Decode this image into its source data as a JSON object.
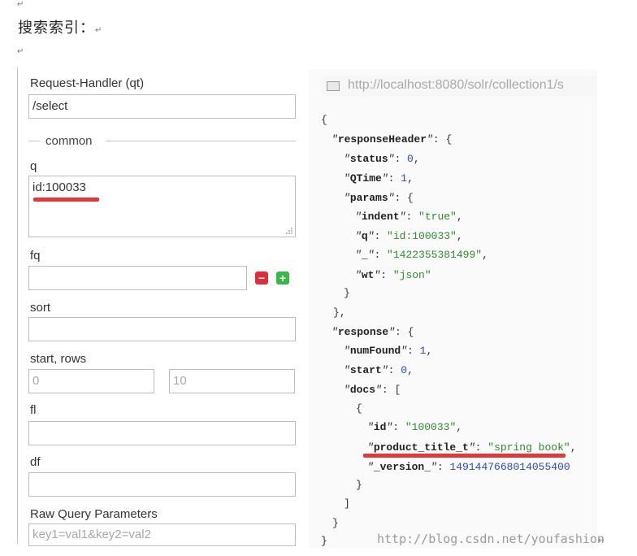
{
  "doc": {
    "heading": "搜索索引：",
    "para_mark": "↵"
  },
  "form": {
    "handler_label": "Request-Handler (qt)",
    "handler_value": "/select",
    "common_label": "common",
    "q_label": "q",
    "q_value": "id:100033",
    "fq_label": "fq",
    "fq_value": "",
    "remove_btn": "−",
    "add_btn": "+",
    "sort_label": "sort",
    "sort_value": "",
    "start_rows_label": "start, rows",
    "start_placeholder": "0",
    "rows_placeholder": "10",
    "fl_label": "fl",
    "fl_value": "",
    "df_label": "df",
    "df_value": "",
    "raw_label": "Raw Query Parameters",
    "raw_placeholder": "key1=val1&key2=val2"
  },
  "response": {
    "url": "http://localhost:8080/solr/collection1/s",
    "open_brace": "{",
    "close_brace": "}",
    "responseHeader_key": "responseHeader",
    "status_key": "status",
    "status_value": "0",
    "qtime_key": "QTime",
    "qtime_value": "1",
    "params_key": "params",
    "indent_key": "indent",
    "indent_value": "\"true\"",
    "q_key": "q",
    "q_value": "\"id:100033\"",
    "underscore_key": "_",
    "underscore_value": "\"1422355381499\"",
    "wt_key": "wt",
    "wt_value": "\"json\"",
    "response_key": "response",
    "numFound_key": "numFound",
    "numFound_value": "1",
    "start_key": "start",
    "start_value": "0",
    "docs_key": "docs",
    "doc_id_key": "id",
    "doc_id_value": "\"100033\"",
    "product_title_key": "product_title_t",
    "product_title_value": "\"spring book\"",
    "version_key": "_version_",
    "version_value": "1491447668014055400"
  },
  "watermark": "http://blog.csdn.net/youfashion",
  "colors": {
    "underline": "#e0393a",
    "remove": "#d9303a",
    "add": "#39b54a",
    "string": "#2e8b2e",
    "number": "#2a49c4"
  }
}
